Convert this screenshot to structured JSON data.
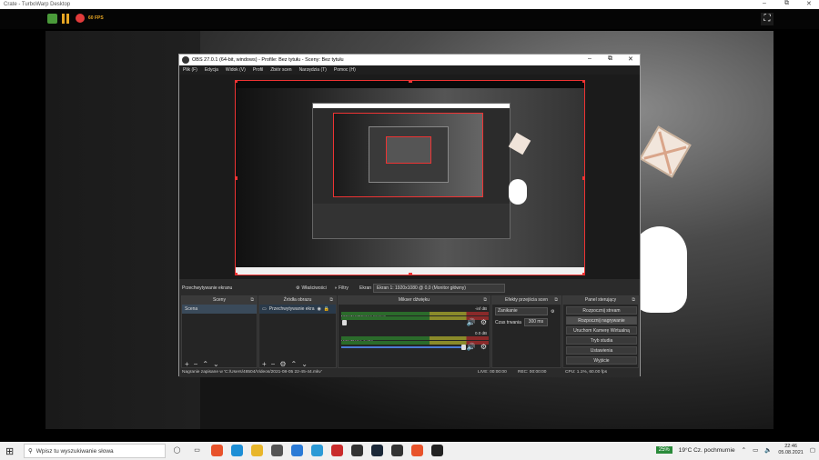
{
  "outer_window": {
    "title": "Crate - TurboWarp Desktop",
    "min": "–",
    "max": "⧉",
    "close": "✕"
  },
  "turbowarp": {
    "fps": "60 FPS",
    "fullscreen_icon": "⛶"
  },
  "obs": {
    "title": "OBS 27.0.1 (64-bit, windows) - Profile: Bez tytułu - Sceny: Bez tytułu",
    "menu": [
      "Plik (F)",
      "Edycja",
      "Widok (V)",
      "Profil",
      "Zbiór scen",
      "Narzędzia (T)",
      "Pomoc (H)"
    ],
    "source_toolbar": {
      "selected_source": "Przechwytywanie ekranu",
      "properties": "Właściwości",
      "filters": "Filtry",
      "screen_label": "Ekran",
      "screen_value": "Ekran 1: 1920x1080 @ 0,0 (Monitor główny)"
    },
    "docks": {
      "scenes": {
        "title": "Sceny",
        "items": [
          "Scena"
        ]
      },
      "sources": {
        "title": "Źródła obrazu",
        "items": [
          "Przechwytywanie ekra"
        ]
      },
      "mixer": {
        "title": "Mikser dźwięku",
        "channels": [
          {
            "name": "Mikrofon/Wejście liniowe",
            "db": "-inf dB"
          },
          {
            "name": "Urządzenie audio",
            "db": "0.0 dB"
          }
        ]
      },
      "transitions": {
        "title": "Efekty przejścia scen",
        "type": "Zanikanie",
        "duration_label": "Czas trwania",
        "duration": "300 ms"
      },
      "controls": {
        "title": "Panel sterujący",
        "buttons": [
          "Rozpocznij stream",
          "Rozpocznij nagrywanie",
          "Uruchom Kamerę Wirtualną",
          "Tryb studia",
          "Ustawienia",
          "Wyjście"
        ]
      }
    },
    "status": {
      "message": "Nagranie zapisane w 'C:/Users/48504/Videos/2021-08-05 22-45-44.mkv'",
      "live": "LIVE: 00:00:00",
      "rec": "REC: 00:00:00",
      "cpu": "CPU: 1.1%, 60.00 fps"
    }
  },
  "taskbar": {
    "search_placeholder": "Wpisz tu wyszukiwanie słowa",
    "battery": "25%",
    "weather": "19°C  Cz. pochmurnie",
    "time": "22:46",
    "date": "05.08.2021",
    "apps": [
      {
        "icon": "brave-icon",
        "color": "#e8532b"
      },
      {
        "icon": "edge-icon",
        "color": "#1d8fd6"
      },
      {
        "icon": "explorer-icon",
        "color": "#e8b62b"
      },
      {
        "icon": "store-icon",
        "color": "#555"
      },
      {
        "icon": "mail-icon",
        "color": "#2b7bd6"
      },
      {
        "icon": "l-app-icon",
        "color": "#2b9ad6"
      },
      {
        "icon": "shield-app-icon",
        "color": "#c92b2b"
      },
      {
        "icon": "xbox-icon",
        "color": "#333"
      },
      {
        "icon": "steam-icon",
        "color": "#1b2838"
      },
      {
        "icon": "xbox2-icon",
        "color": "#333"
      },
      {
        "icon": "brave2-icon",
        "color": "#e8532b"
      },
      {
        "icon": "obs-icon",
        "color": "#222"
      }
    ]
  }
}
